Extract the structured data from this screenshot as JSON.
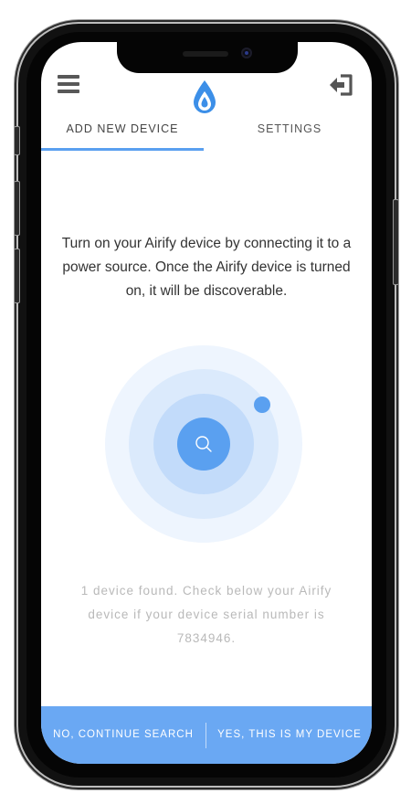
{
  "header": {
    "menu_icon": "hamburger-menu-icon",
    "logo_icon": "water-drop-icon",
    "logout_icon": "logout-icon"
  },
  "tabs": [
    {
      "label": "ADD NEW DEVICE",
      "active": true
    },
    {
      "label": "SETTINGS",
      "active": false
    }
  ],
  "instructions": "Turn on your Airify device by connecting it to a power source. Once the Airify device is turned on, it will be discoverable.",
  "scan": {
    "icon": "search-icon",
    "found_message": "1 device found. Check below your Airify device if your device serial number is 7834946."
  },
  "actions": {
    "continue_search_label": "NO, CONTINUE SEARCH",
    "confirm_label": "YES, THIS IS MY DEVICE"
  },
  "colors": {
    "accent": "#5aa0f0",
    "bottom_bar": "#6aa8f3",
    "text": "#333333",
    "muted_text": "#b9b9b9"
  }
}
